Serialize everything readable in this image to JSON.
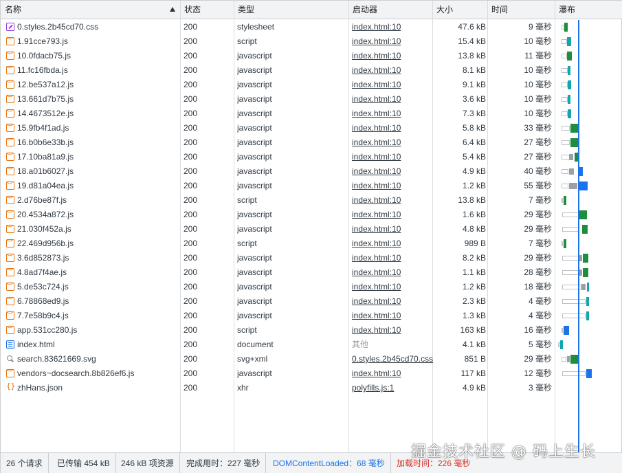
{
  "columns": {
    "name": "名称",
    "status": "状态",
    "type": "类型",
    "initiator": "启动器",
    "size": "大小",
    "time": "时间",
    "waterfall": "瀑布"
  },
  "rows": [
    {
      "name": "0.styles.2b45cd70.css",
      "icon": "css",
      "status": "200",
      "type": "stylesheet",
      "initiator": "index.html:10",
      "size": "47.6 kB",
      "time": "9 毫秒"
    },
    {
      "name": "1.91cce793.js",
      "icon": "js",
      "status": "200",
      "type": "script",
      "initiator": "index.html:10",
      "size": "15.4 kB",
      "time": "10 毫秒"
    },
    {
      "name": "10.0fdacb75.js",
      "icon": "js",
      "status": "200",
      "type": "javascript",
      "initiator": "index.html:10",
      "size": "13.8 kB",
      "time": "11 毫秒"
    },
    {
      "name": "11.fc16fbda.js",
      "icon": "js",
      "status": "200",
      "type": "javascript",
      "initiator": "index.html:10",
      "size": "8.1 kB",
      "time": "10 毫秒"
    },
    {
      "name": "12.be537a12.js",
      "icon": "js",
      "status": "200",
      "type": "javascript",
      "initiator": "index.html:10",
      "size": "9.1 kB",
      "time": "10 毫秒"
    },
    {
      "name": "13.661d7b75.js",
      "icon": "js",
      "status": "200",
      "type": "javascript",
      "initiator": "index.html:10",
      "size": "3.6 kB",
      "time": "10 毫秒"
    },
    {
      "name": "14.4673512e.js",
      "icon": "js",
      "status": "200",
      "type": "javascript",
      "initiator": "index.html:10",
      "size": "7.3 kB",
      "time": "10 毫秒"
    },
    {
      "name": "15.9fb4f1ad.js",
      "icon": "js",
      "status": "200",
      "type": "javascript",
      "initiator": "index.html:10",
      "size": "5.8 kB",
      "time": "33 毫秒"
    },
    {
      "name": "16.b0b6e33b.js",
      "icon": "js",
      "status": "200",
      "type": "javascript",
      "initiator": "index.html:10",
      "size": "6.4 kB",
      "time": "27 毫秒"
    },
    {
      "name": "17.10ba81a9.js",
      "icon": "js",
      "status": "200",
      "type": "javascript",
      "initiator": "index.html:10",
      "size": "5.4 kB",
      "time": "27 毫秒"
    },
    {
      "name": "18.a01b6027.js",
      "icon": "js",
      "status": "200",
      "type": "javascript",
      "initiator": "index.html:10",
      "size": "4.9 kB",
      "time": "40 毫秒"
    },
    {
      "name": "19.d81a04ea.js",
      "icon": "js",
      "status": "200",
      "type": "javascript",
      "initiator": "index.html:10",
      "size": "1.2 kB",
      "time": "55 毫秒"
    },
    {
      "name": "2.d76be87f.js",
      "icon": "js",
      "status": "200",
      "type": "script",
      "initiator": "index.html:10",
      "size": "13.8 kB",
      "time": "7 毫秒"
    },
    {
      "name": "20.4534a872.js",
      "icon": "js",
      "status": "200",
      "type": "javascript",
      "initiator": "index.html:10",
      "size": "1.6 kB",
      "time": "29 毫秒"
    },
    {
      "name": "21.030f452a.js",
      "icon": "js",
      "status": "200",
      "type": "javascript",
      "initiator": "index.html:10",
      "size": "4.8 kB",
      "time": "29 毫秒"
    },
    {
      "name": "22.469d956b.js",
      "icon": "js",
      "status": "200",
      "type": "script",
      "initiator": "index.html:10",
      "size": "989 B",
      "time": "7 毫秒"
    },
    {
      "name": "3.6d852873.js",
      "icon": "js",
      "status": "200",
      "type": "javascript",
      "initiator": "index.html:10",
      "size": "8.2 kB",
      "time": "29 毫秒"
    },
    {
      "name": "4.8ad7f4ae.js",
      "icon": "js",
      "status": "200",
      "type": "javascript",
      "initiator": "index.html:10",
      "size": "1.1 kB",
      "time": "28 毫秒"
    },
    {
      "name": "5.de53c724.js",
      "icon": "js",
      "status": "200",
      "type": "javascript",
      "initiator": "index.html:10",
      "size": "1.2 kB",
      "time": "18 毫秒"
    },
    {
      "name": "6.78868ed9.js",
      "icon": "js",
      "status": "200",
      "type": "javascript",
      "initiator": "index.html:10",
      "size": "2.3 kB",
      "time": "4 毫秒"
    },
    {
      "name": "7.7e58b9c4.js",
      "icon": "js",
      "status": "200",
      "type": "javascript",
      "initiator": "index.html:10",
      "size": "1.3 kB",
      "time": "4 毫秒"
    },
    {
      "name": "app.531cc280.js",
      "icon": "js",
      "status": "200",
      "type": "script",
      "initiator": "index.html:10",
      "size": "163 kB",
      "time": "16 毫秒"
    },
    {
      "name": "index.html",
      "icon": "doc",
      "status": "200",
      "type": "document",
      "initiator": "其他",
      "size": "4.1 kB",
      "time": "5 毫秒"
    },
    {
      "name": "search.83621669.svg",
      "icon": "img",
      "status": "200",
      "type": "svg+xml",
      "initiator": "0.styles.2b45cd70.css",
      "size": "851 B",
      "time": "29 毫秒"
    },
    {
      "name": "vendors~docsearch.8b826ef6.js",
      "icon": "js",
      "status": "200",
      "type": "javascript",
      "initiator": "index.html:10",
      "size": "117 kB",
      "time": "12 毫秒"
    },
    {
      "name": "zhHans.json",
      "icon": "xhr",
      "status": "200",
      "type": "xhr",
      "initiator": "polyfills.js:1",
      "size": "4.9 kB",
      "time": "3 毫秒"
    }
  ],
  "status_bar": {
    "requests": "26 个请求",
    "transferred": "已传输 454 kB",
    "resources": "246 kB 项资源",
    "finish": "完成用时：227 毫秒",
    "dcl": "DOMContentLoaded：68 毫秒",
    "load": "加载时间：226 毫秒"
  },
  "watermark": "掘金技术社区 @ 码上生长",
  "colors": {
    "receive_green": "#1e8e3e",
    "receive_teal": "#34a853",
    "receive_blue": "#1a73e8",
    "dcl_line": "#1a73e8",
    "load_text": "#d93025"
  }
}
